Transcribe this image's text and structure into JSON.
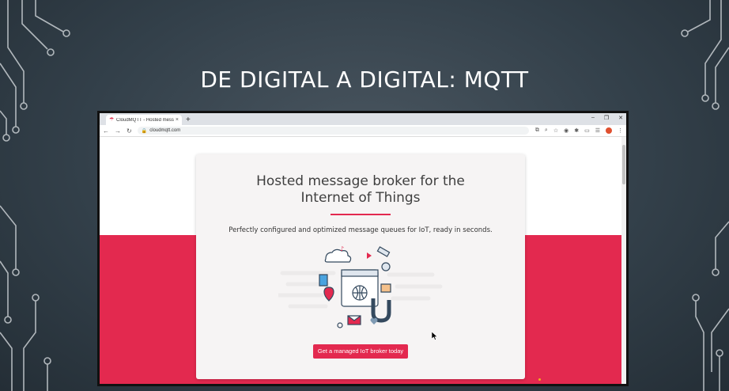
{
  "slide": {
    "title": "DE DIGITAL A DIGITAL: MQTT"
  },
  "browser": {
    "tab_title": "CloudMQTT - Hosted message b",
    "tab_close": "×",
    "new_tab": "+",
    "url": "cloudmqtt.com",
    "window_controls": {
      "minimize": "–",
      "maximize": "❐",
      "close": "✕"
    },
    "profile_initial": ""
  },
  "page": {
    "hero_title": "Hosted message broker for the Internet of Things",
    "subtitle": "Perfectly configured and optimized message queues for IoT, ready in seconds.",
    "cta_label": "Get a managed IoT broker today",
    "colors": {
      "accent": "#e3294f",
      "card": "#f6f4f4",
      "slide_bg": "#33404a"
    }
  }
}
